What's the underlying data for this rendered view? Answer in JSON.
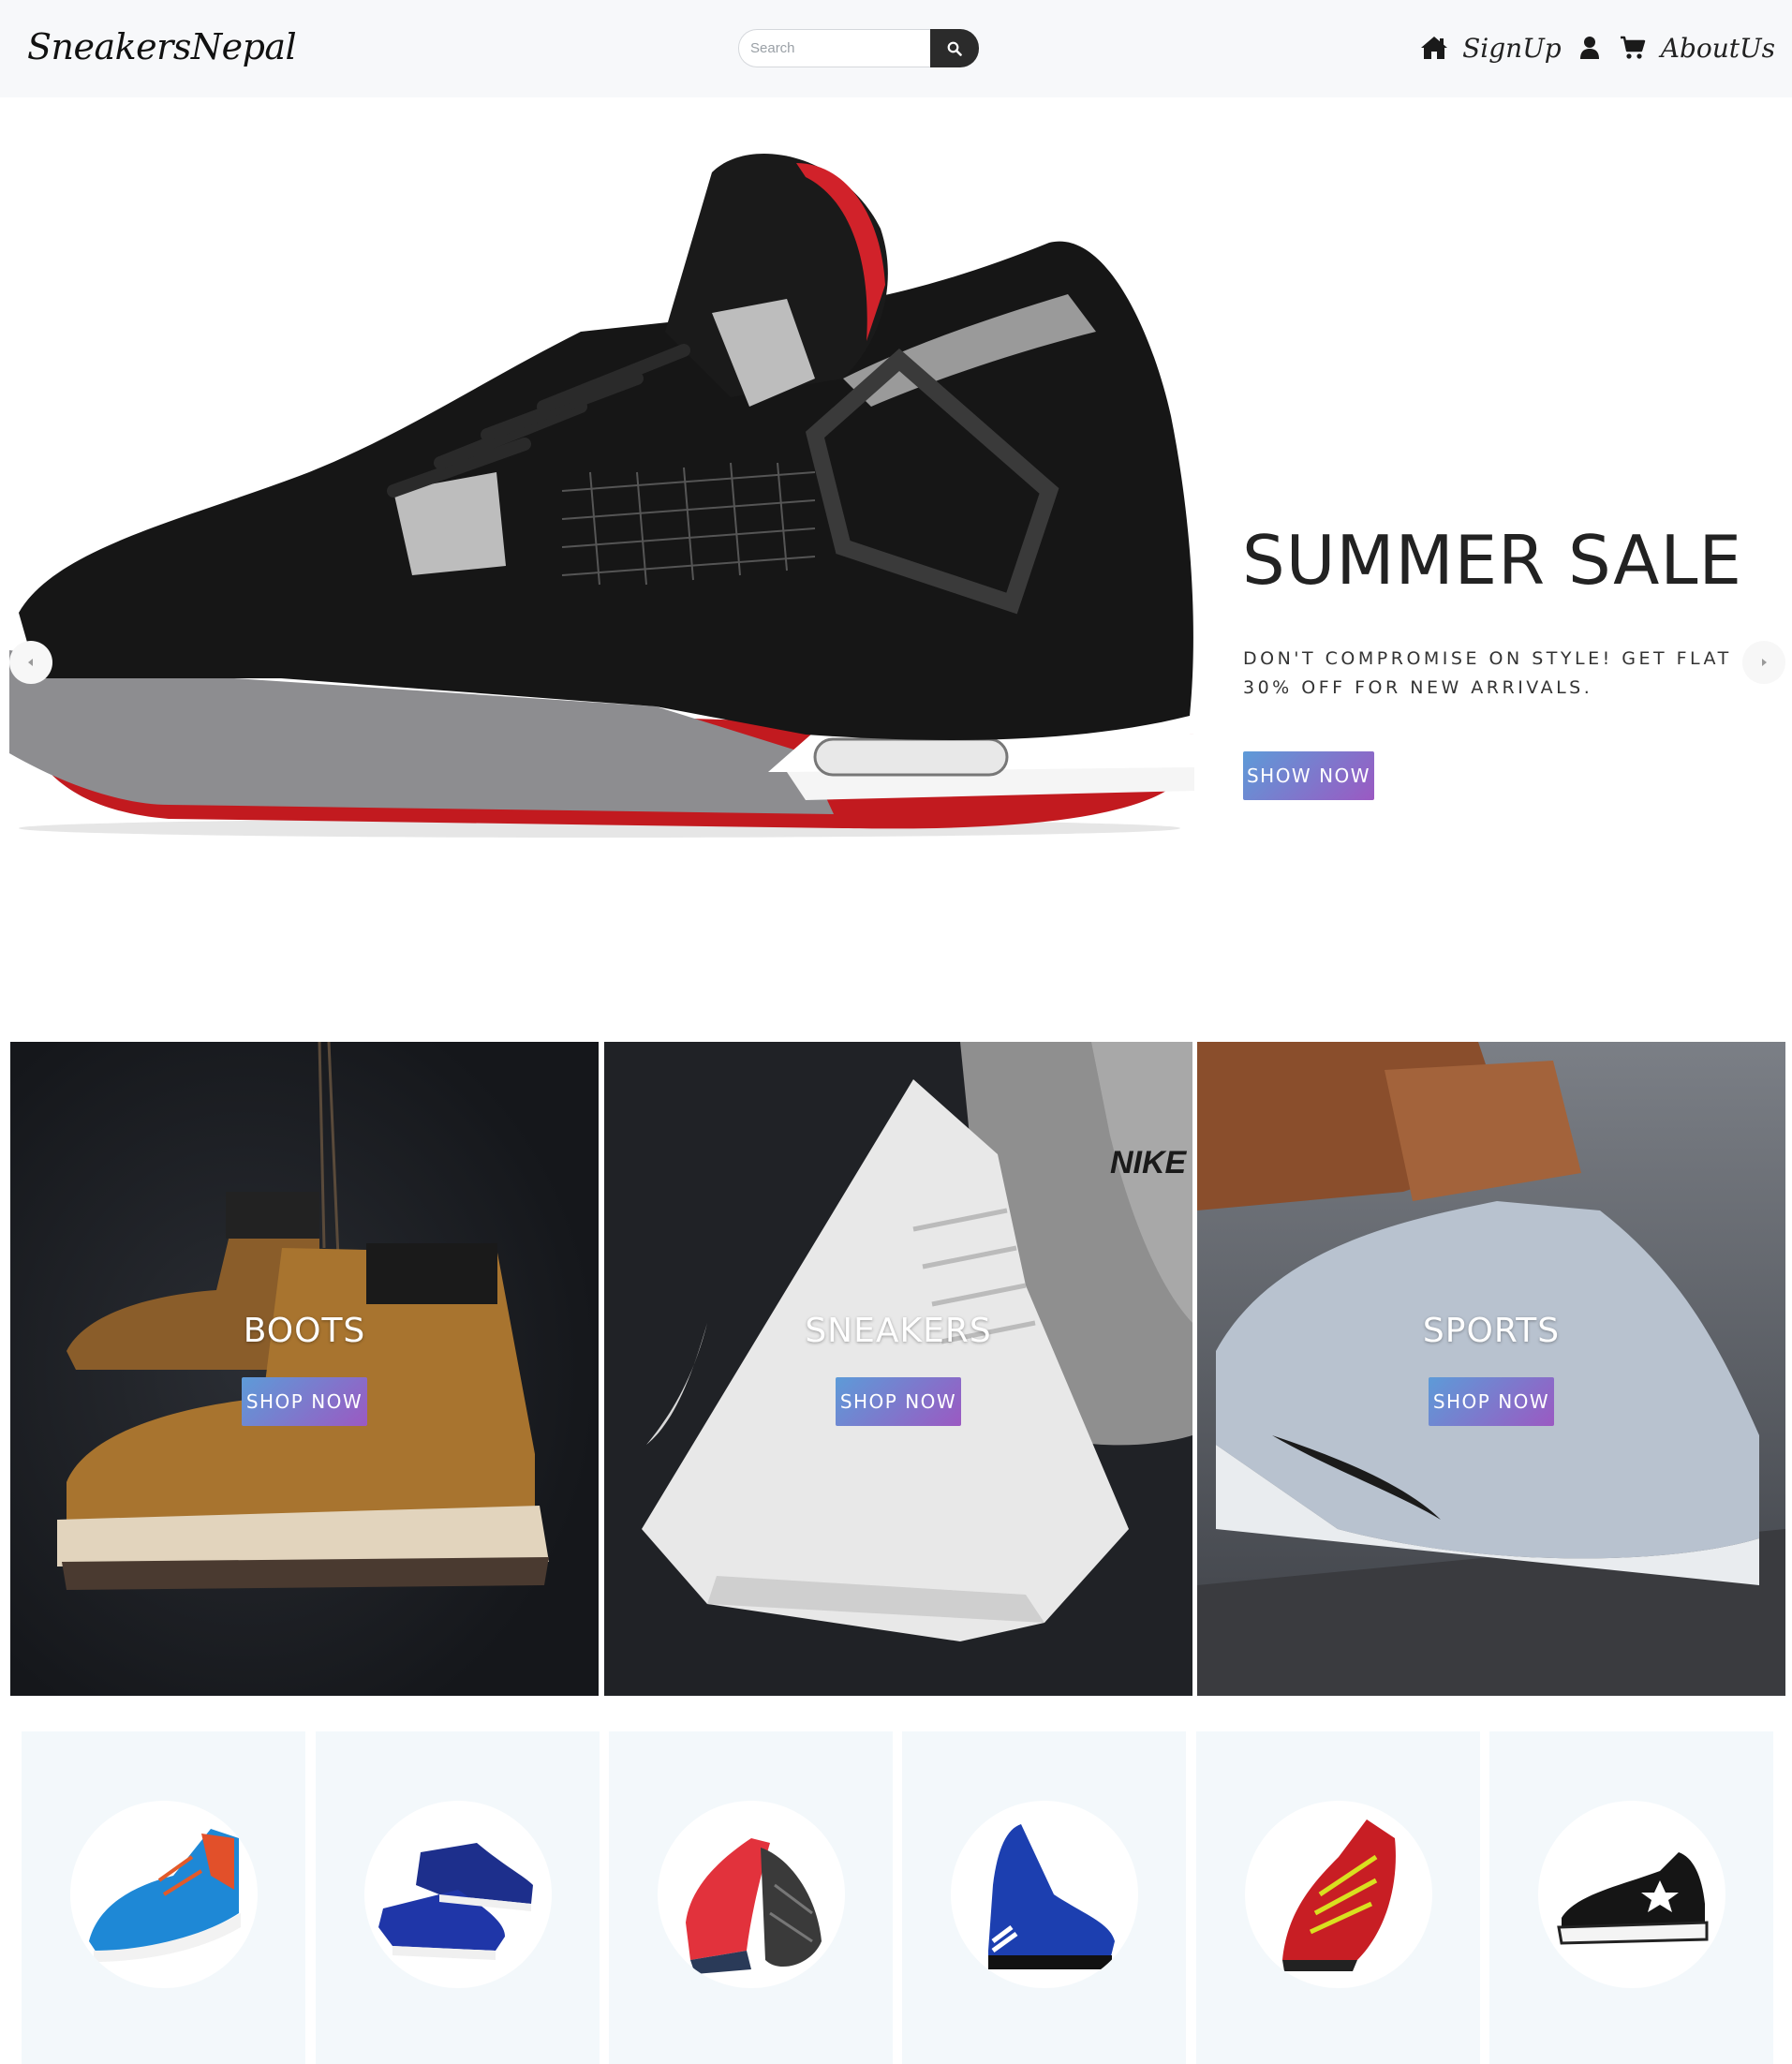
{
  "navbar": {
    "brand": "SneakersNepal",
    "search": {
      "placeholder": "Search",
      "value": ""
    },
    "links": {
      "signup": "SignUp",
      "about": "AboutUs"
    },
    "icons": [
      "home-icon",
      "search-icon",
      "user-icon",
      "cart-icon"
    ]
  },
  "hero": {
    "title": "SUMMER SALE",
    "description": "DON'T COMPROMISE ON STYLE! GET FLAT 30% OFF FOR NEW ARRIVALS.",
    "button": "SHOW NOW"
  },
  "categories": [
    {
      "title": "BOOTS",
      "button": "SHOP NOW"
    },
    {
      "title": "SNEAKERS",
      "button": "SHOP NOW"
    },
    {
      "title": "SPORTS",
      "button": "SHOP NOW"
    }
  ],
  "products": [
    {
      "image": "blue-running-shoe"
    },
    {
      "image": "navy-boat-shoe"
    },
    {
      "image": "red-black-trainer"
    },
    {
      "image": "blue-high-top"
    },
    {
      "image": "red-yellow-runner"
    },
    {
      "image": "black-canvas-sneaker"
    }
  ],
  "colors": {
    "accent_gradient_start": "#5d9bd8",
    "accent_gradient_end": "#9b59c2",
    "navbar_bg": "#f7f8fa",
    "card_bg": "#f3f8fb",
    "search_button": "#2b2b2b"
  }
}
